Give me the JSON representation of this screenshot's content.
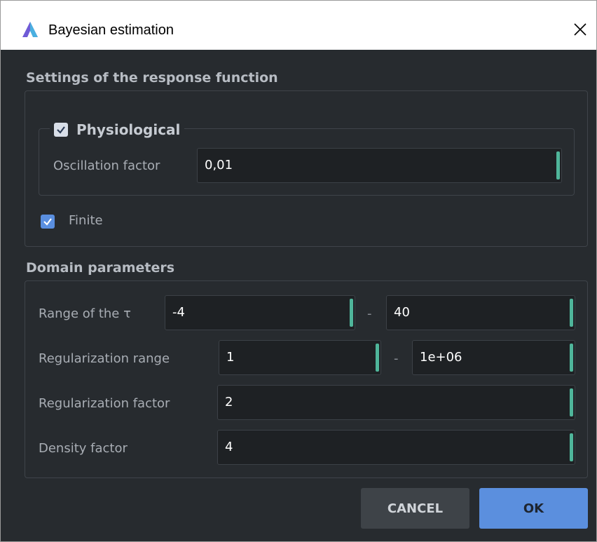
{
  "window": {
    "title": "Bayesian estimation"
  },
  "response": {
    "title": "Settings of the response function",
    "physiological": {
      "label": "Physiological",
      "checked": true
    },
    "oscillation_label": "Oscillation factor",
    "oscillation_value": "0,01",
    "finite": {
      "label": "Finite",
      "checked": true
    }
  },
  "domain": {
    "title": "Domain parameters",
    "range_tau": {
      "label": "Range of the τ",
      "from": "-4",
      "to": "40"
    },
    "reg_range": {
      "label": "Regularization range",
      "from": "1",
      "to": "1e+06"
    },
    "reg_factor": {
      "label": "Regularization factor",
      "value": "2"
    },
    "density": {
      "label": "Density factor",
      "value": "4"
    },
    "separator": "-"
  },
  "buttons": {
    "cancel": "CANCEL",
    "ok": "OK"
  },
  "colors": {
    "background": "#272b2f",
    "accent": "#5b8fde",
    "field_marker": "#4fb59a"
  }
}
